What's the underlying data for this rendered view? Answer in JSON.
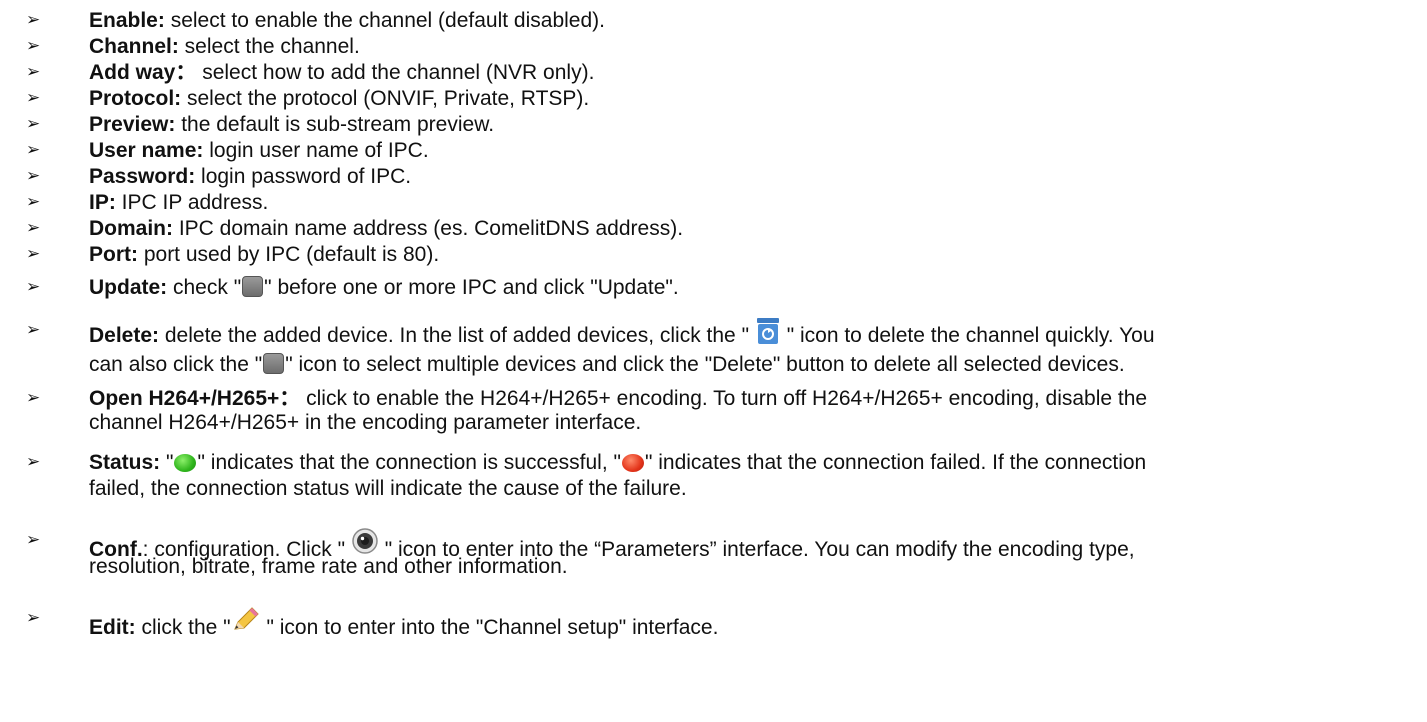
{
  "items": [
    {
      "bold": "Enable:",
      "text": " select to enable the channel (default disabled)."
    },
    {
      "bold": "Channel:",
      "text": " select the channel."
    },
    {
      "bold": "Add way：",
      "text": " select how to add the channel (NVR only)."
    },
    {
      "bold": "Protocol:",
      "text": " select the protocol (ONVIF, Private, RTSP)."
    },
    {
      "bold": "Preview:",
      "text": " the default is sub-stream preview."
    },
    {
      "bold": "User name:",
      "text": " login user name of IPC."
    },
    {
      "bold": "Password:",
      "text": " login password of IPC."
    },
    {
      "bold": "IP:",
      "text": " IPC IP address."
    },
    {
      "bold": "Domain:",
      "text": " IPC domain name address (es. ComelitDNS address)."
    },
    {
      "bold": "Port:",
      "text": " port used by IPC (default is 80)."
    }
  ],
  "update": {
    "bold": "Update:",
    "t1": " check \"",
    "t2": "\" before one or more IPC and click \"Update\"."
  },
  "delete": {
    "bold": "Delete:",
    "t1": " delete the added device. In the list of added devices, click the \" ",
    "t2": " \" icon to delete the channel quickly. You",
    "c1": "can also click the \"",
    "c2": "\" icon to select multiple devices and click the \"Delete\" button to delete all selected devices."
  },
  "h264": {
    "bold": "Open H264+/H265+：",
    "t1": " click to enable the H264+/H265+ encoding. To turn off H264+/H265+ encoding, disable the",
    "c1": "channel H264+/H265+ in the encoding parameter interface."
  },
  "status": {
    "bold": "Status:",
    "t1": " \"",
    "t2": "\" indicates that the connection is successful, \"",
    "t3": "\" indicates that the connection failed. If the connection",
    "c1": "failed, the connection status will indicate the cause of the failure."
  },
  "conf": {
    "bold": "Conf.",
    "t1": ": configuration. Click \" ",
    "t2": " \" icon to enter into the “Parameters” interface. You can modify the encoding type,",
    "c1": "resolution, bitrate, frame rate and other information."
  },
  "edit": {
    "bold": "Edit:",
    "t1": " click the \"",
    "t2": " \" icon to enter into the \"Channel setup\" interface."
  },
  "bullet": "➢",
  "icons": {
    "checkbox": "checkbox-icon",
    "trash": "recycle-bin-icon",
    "green": "green-dot-icon",
    "red": "red-dot-icon",
    "camera": "camera-icon",
    "pencil": "pencil-icon"
  }
}
